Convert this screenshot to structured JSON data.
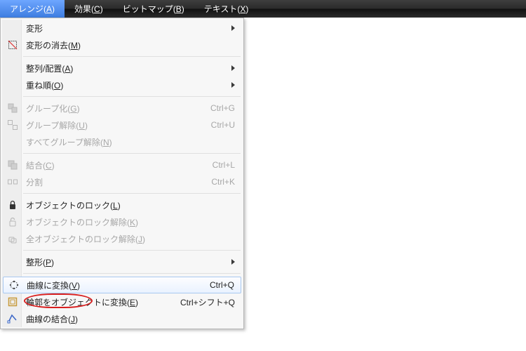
{
  "menubar": {
    "items": [
      {
        "label": "アレンジ",
        "accel": "A",
        "active": true
      },
      {
        "label": "効果",
        "accel": "C",
        "active": false
      },
      {
        "label": "ビットマップ",
        "accel": "B",
        "active": false
      },
      {
        "label": "テキスト",
        "accel": "X",
        "active": false
      }
    ]
  },
  "menu": {
    "groups": [
      [
        {
          "id": "transform",
          "label": "変形",
          "submenu": true,
          "enabled": true
        },
        {
          "id": "clear-transform",
          "label": "変形の消去(M)",
          "enabled": true,
          "icon": "clear-transform"
        }
      ],
      [
        {
          "id": "align",
          "label": "整列/配置(A)",
          "submenu": true,
          "enabled": true
        },
        {
          "id": "order",
          "label": "重ね順(O)",
          "submenu": true,
          "enabled": true
        }
      ],
      [
        {
          "id": "group",
          "label": "グループ化(G)",
          "shortcut": "Ctrl+G",
          "enabled": false,
          "icon": "group"
        },
        {
          "id": "ungroup",
          "label": "グループ解除(U)",
          "shortcut": "Ctrl+U",
          "enabled": false,
          "icon": "ungroup"
        },
        {
          "id": "ungroup-all",
          "label": "すべてグループ解除(N)",
          "enabled": false
        }
      ],
      [
        {
          "id": "combine",
          "label": "結合(C)",
          "shortcut": "Ctrl+L",
          "enabled": false,
          "icon": "combine"
        },
        {
          "id": "break",
          "label": "分割",
          "shortcut": "Ctrl+K",
          "enabled": false,
          "icon": "break"
        }
      ],
      [
        {
          "id": "lock",
          "label": "オブジェクトのロック(L)",
          "enabled": true,
          "icon": "lock"
        },
        {
          "id": "unlock",
          "label": "オブジェクトのロック解除(K)",
          "enabled": false,
          "icon": "unlock"
        },
        {
          "id": "unlock-all",
          "label": "全オブジェクトのロック解除(J)",
          "enabled": false,
          "icon": "unlock-all"
        }
      ],
      [
        {
          "id": "shaping",
          "label": "整形(P)",
          "submenu": true,
          "enabled": true
        }
      ],
      [
        {
          "id": "to-curves",
          "label": "曲線に変換(V)",
          "shortcut": "Ctrl+Q",
          "enabled": true,
          "icon": "to-curves",
          "highlight": true
        },
        {
          "id": "outline-to-object",
          "label": "輪郭をオブジェクトに変換(E)",
          "shortcut": "Ctrl+シフト+Q",
          "enabled": true,
          "icon": "outline-object"
        },
        {
          "id": "join-curves",
          "label": "曲線の結合(J)",
          "enabled": true,
          "icon": "join-curves"
        }
      ]
    ]
  }
}
